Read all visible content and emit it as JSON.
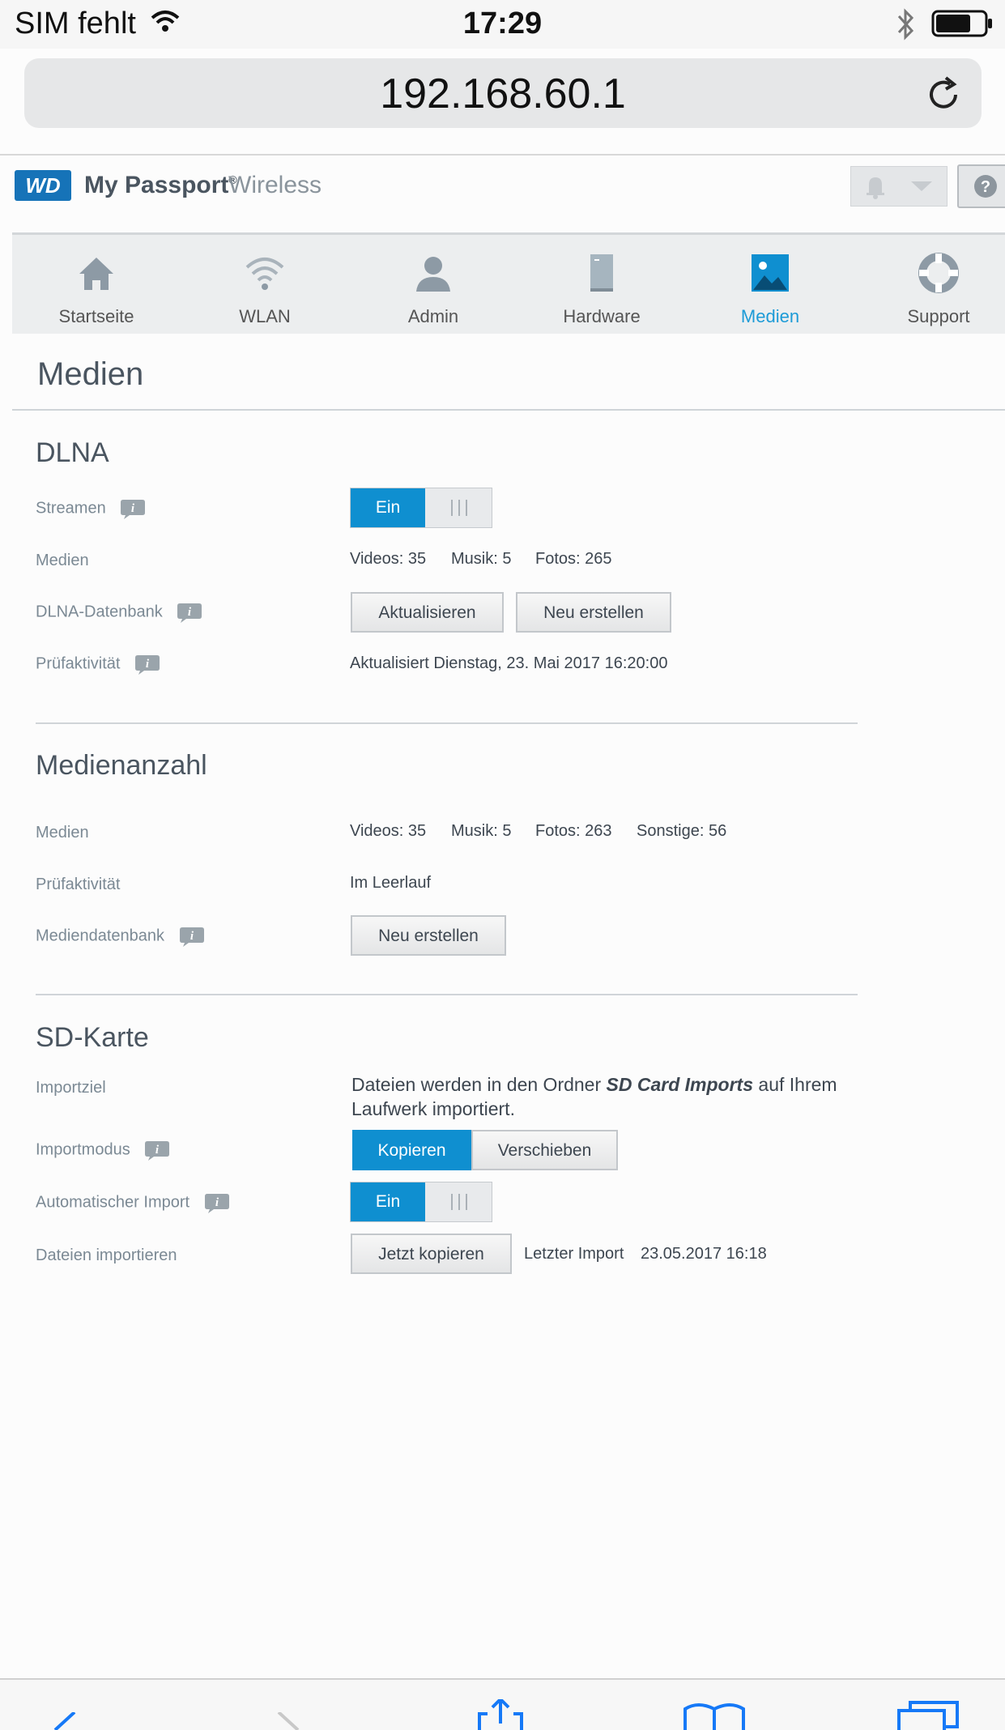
{
  "status_bar": {
    "carrier": "SIM fehlt",
    "time": "17:29"
  },
  "browser": {
    "url": "192.168.60.1"
  },
  "header": {
    "brand_name": "My Passport",
    "brand_reg": "®",
    "brand_suffix": "Wireless",
    "help": "?"
  },
  "nav": [
    {
      "label": "Startseite",
      "icon": "home-icon"
    },
    {
      "label": "WLAN",
      "icon": "wifi-icon"
    },
    {
      "label": "Admin",
      "icon": "user-icon"
    },
    {
      "label": "Hardware",
      "icon": "hardware-icon"
    },
    {
      "label": "Medien",
      "icon": "media-icon",
      "active": true
    },
    {
      "label": "Support",
      "icon": "lifebuoy-icon"
    }
  ],
  "page_title": "Medien",
  "dlna": {
    "title": "DLNA",
    "streaming_label": "Streamen",
    "streaming_toggle": "Ein",
    "media_label": "Medien",
    "videos": "Videos: 35",
    "music": "Musik: 5",
    "photos": "Fotos: 265",
    "db_label": "DLNA-Datenbank",
    "update_button": "Aktualisieren",
    "rebuild_button": "Neu erstellen",
    "scan_label": "Prüfaktivität",
    "scan_value": "Aktualisiert Dienstag, 23. Mai 2017 16:20:00"
  },
  "media_count": {
    "title": "Medienanzahl",
    "media_label": "Medien",
    "videos": "Videos: 35",
    "music": "Musik: 5",
    "photos": "Fotos: 263",
    "other": "Sonstige: 56",
    "scan_label": "Prüfaktivität",
    "scan_value": "Im Leerlauf",
    "db_label": "Mediendatenbank",
    "rebuild_button": "Neu erstellen"
  },
  "sd_card": {
    "title": "SD-Karte",
    "target_label": "Importziel",
    "target_text_1": "Dateien werden in den Ordner ",
    "target_folder": "SD Card Imports",
    "target_text_2": " auf Ihrem",
    "target_text_3": "Laufwerk importiert.",
    "mode_label": "Importmodus",
    "mode_copy": "Kopieren",
    "mode_move": "Verschieben",
    "auto_label": "Automatischer Import",
    "auto_toggle": "Ein",
    "files_label": "Dateien importieren",
    "copy_now_button": "Jetzt kopieren",
    "last_import_label": "Letzter Import",
    "last_import_value": "23.05.2017 16:18"
  },
  "colors": {
    "accent": "#0f8fd0",
    "brand": "#1673b8"
  }
}
